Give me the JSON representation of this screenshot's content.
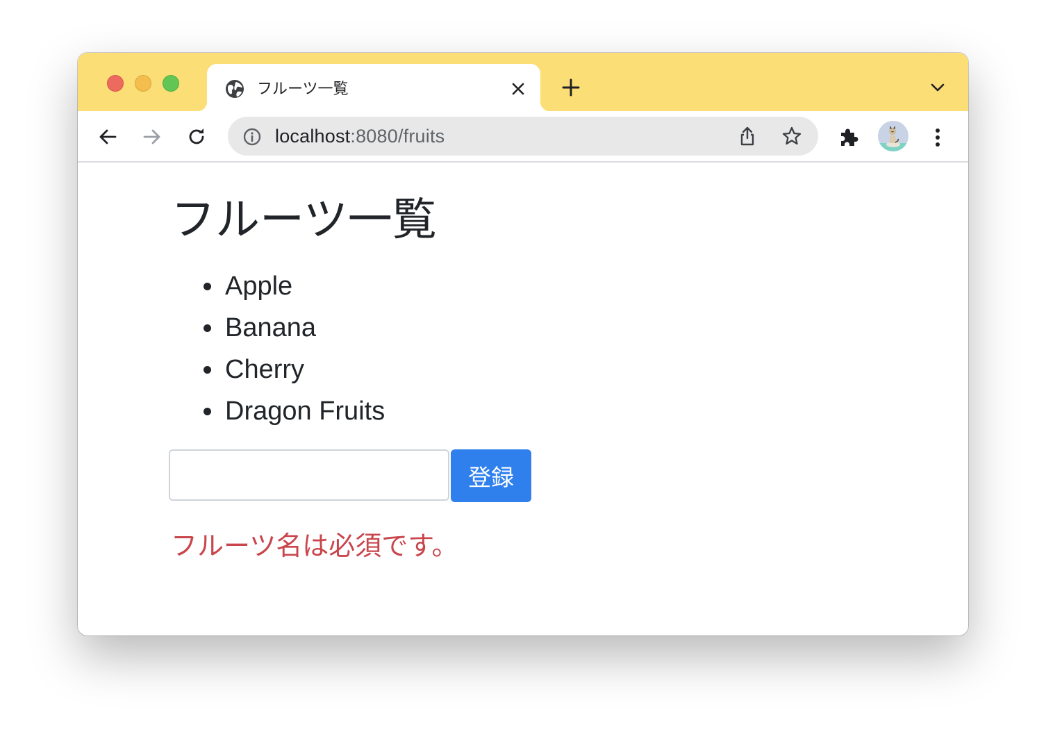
{
  "window": {
    "controls": [
      "close",
      "minimize",
      "zoom"
    ],
    "titlebar_color": "#fcde77"
  },
  "tab": {
    "title": "フルーツ一覧",
    "favicon": "globe-icon"
  },
  "toolbar": {
    "url_host": "localhost",
    "url_path": ":8080/fruits",
    "buttons": [
      "back-icon",
      "forward-icon",
      "reload-icon",
      "info-icon",
      "share-icon",
      "star-icon",
      "puzzle-icon",
      "avatar",
      "kebab-menu-icon"
    ]
  },
  "page": {
    "title": "フルーツ一覧",
    "fruits": [
      "Apple",
      "Banana",
      "Cherry",
      "Dragon Fruits"
    ],
    "input_value": "",
    "submit_label": "登録",
    "error_message": "フルーツ名は必須です。",
    "colors": {
      "button": "#2f80ed",
      "error": "#c8464c",
      "text": "#212529"
    }
  }
}
